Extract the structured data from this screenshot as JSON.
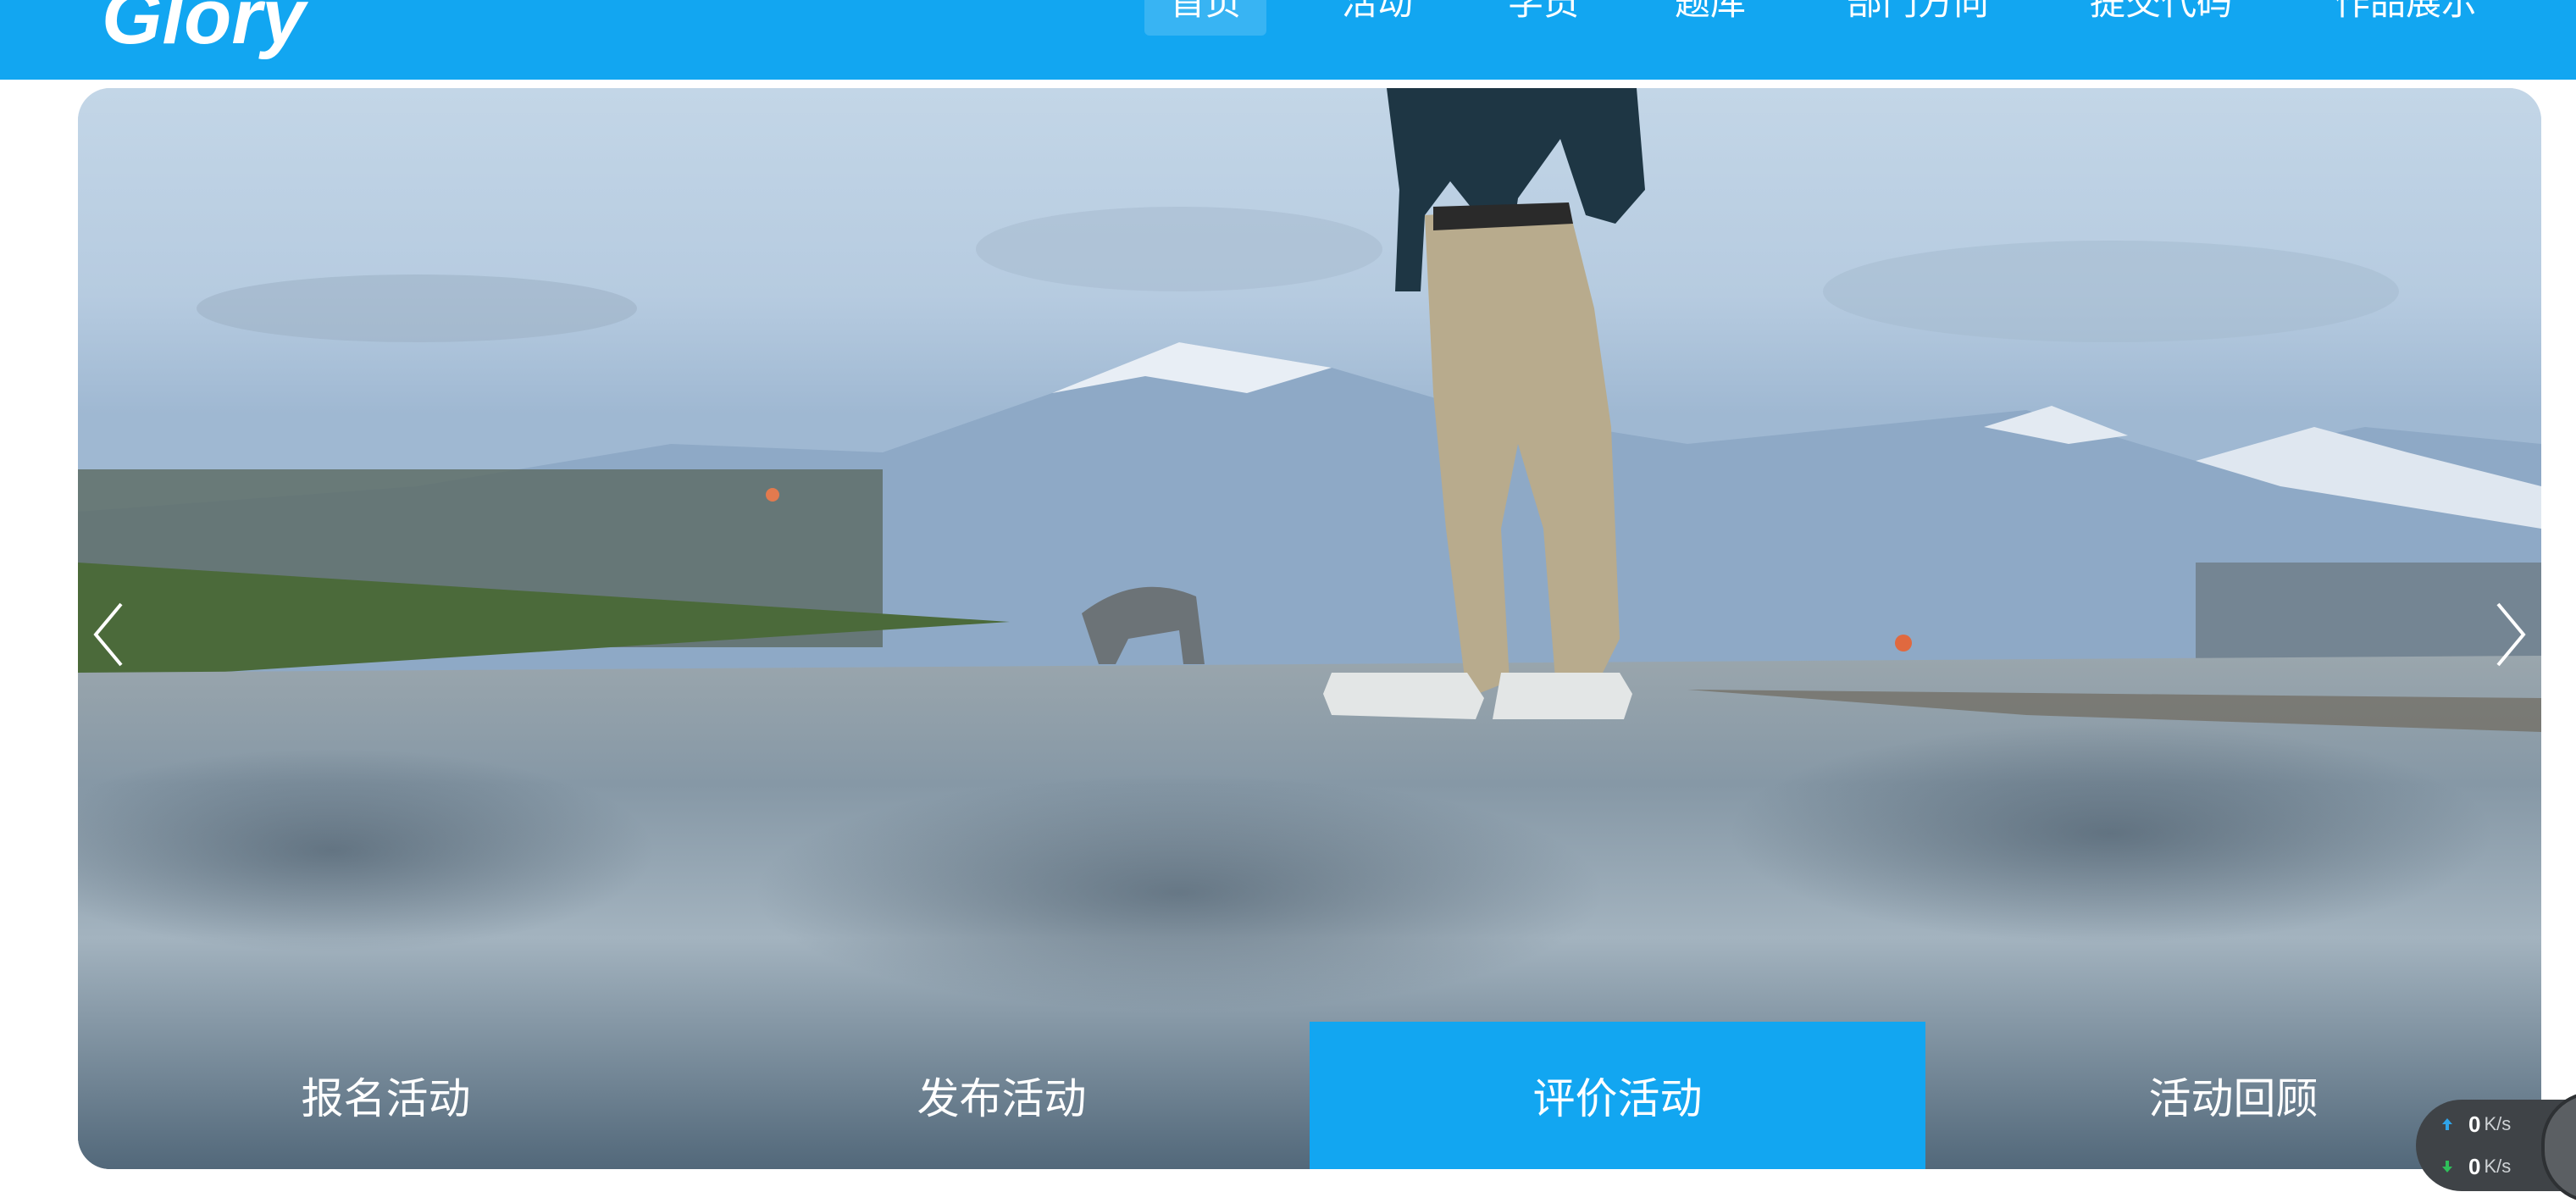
{
  "header": {
    "logo": "Glory",
    "nav": [
      {
        "label": "首页",
        "active": true
      },
      {
        "label": "活动"
      },
      {
        "label": "学员"
      },
      {
        "label": "题库"
      },
      {
        "label": "部门方向"
      },
      {
        "label": "提交代码"
      },
      {
        "label": "作品展示"
      }
    ]
  },
  "carousel": {
    "prev_icon": "chevron-left-icon",
    "next_icon": "chevron-right-icon",
    "tabs": [
      {
        "label": "报名活动"
      },
      {
        "label": "发布活动"
      },
      {
        "label": "评价活动",
        "active": true
      },
      {
        "label": "活动回顾"
      }
    ]
  },
  "network_widget": {
    "upload": {
      "value": "0",
      "unit": "K/s"
    },
    "download": {
      "value": "0",
      "unit": "K/s"
    }
  },
  "colors": {
    "accent": "#12a6f1",
    "widget_bg": "#3f4347"
  }
}
